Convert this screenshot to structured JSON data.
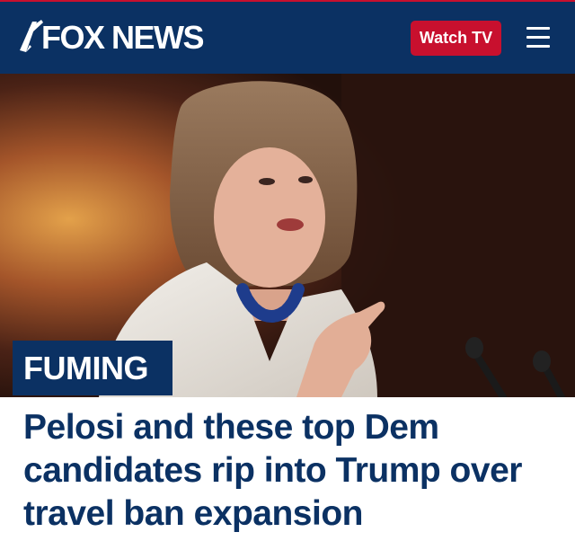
{
  "header": {
    "logo_text": "FOX NEWS",
    "watch_label": "Watch TV",
    "brand_color": "#0b3163",
    "accent_color": "#c8102e",
    "menu_icon": "hamburger-menu-icon"
  },
  "article": {
    "badge": "FUMING",
    "headline": "Pelosi and these top Dem candidates rip into Trump over travel ban expansion",
    "image_alt": "Woman in white jacket and blue necklace speaking and pointing at podium microphones"
  }
}
